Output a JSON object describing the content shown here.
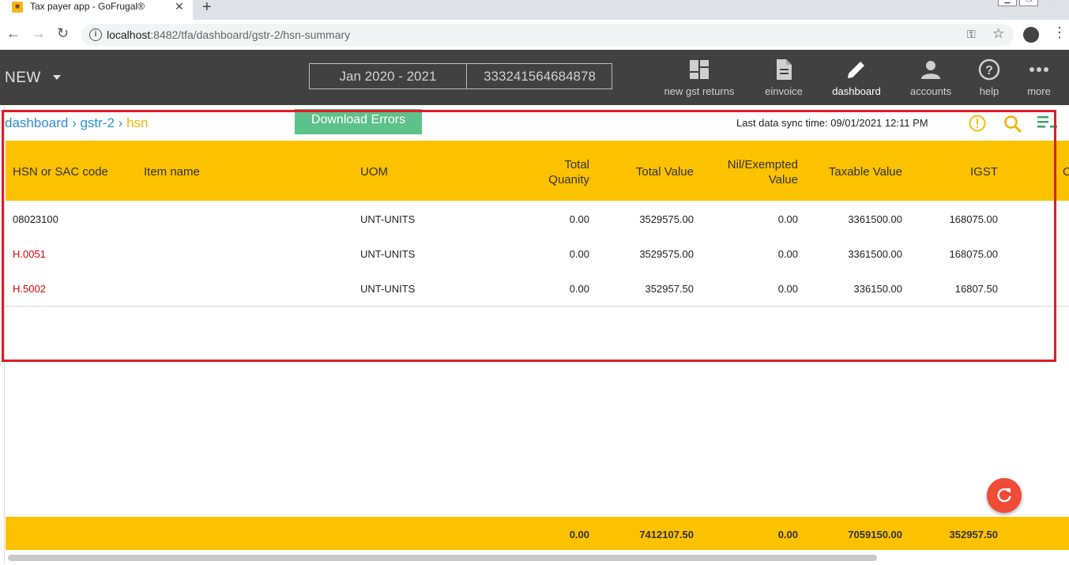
{
  "browser": {
    "tab_title": "Tax payer app - GoFrugal®",
    "url_host": "localhost",
    "url_path": ":8482/tfa/dashboard/gstr-2/hsn-summary"
  },
  "header": {
    "new_label": "NEW",
    "period": "Jan 2020 - 2021",
    "gstin": "333241564684878",
    "nav": [
      {
        "label": "new gst returns",
        "icon": "dashboard-grid-icon"
      },
      {
        "label": "einvoice",
        "icon": "document-icon"
      },
      {
        "label": "dashboard",
        "icon": "pencil-icon"
      },
      {
        "label": "accounts",
        "icon": "person-icon"
      },
      {
        "label": "help",
        "icon": "help-circle-icon"
      },
      {
        "label": "more",
        "icon": "more-dots-icon"
      }
    ]
  },
  "breadcrumb": {
    "items": [
      "dashboard",
      "gstr-2",
      "hsn"
    ],
    "sep": ">"
  },
  "download_errors_label": "Download Errors",
  "sync_text": "Last data sync time: 09/01/2021 12:11 PM",
  "table": {
    "headers": {
      "hsn": "HSN or SAC code",
      "item": "Item name",
      "uom": "UOM",
      "qty_1": "Total",
      "qty_2": "Quanity",
      "value": "Total Value",
      "nil_1": "Nil/Exempted",
      "nil_2": "Value",
      "taxable": "Taxable Value",
      "igst": "IGST",
      "partial": "C"
    },
    "rows": [
      {
        "hsn": "08023100",
        "item": "",
        "uom": "UNT-UNITS",
        "qty": "0.00",
        "value": "3529575.00",
        "nil": "0.00",
        "taxable": "3361500.00",
        "igst": "168075.00"
      },
      {
        "hsn": "H.0051",
        "item": "",
        "uom": "UNT-UNITS",
        "qty": "0.00",
        "value": "3529575.00",
        "nil": "0.00",
        "taxable": "3361500.00",
        "igst": "168075.00"
      },
      {
        "hsn": "H.5002",
        "item": "",
        "uom": "UNT-UNITS",
        "qty": "0.00",
        "value": "352957.50",
        "nil": "0.00",
        "taxable": "336150.00",
        "igst": "16807.50"
      }
    ],
    "totals": {
      "qty": "0.00",
      "value": "7412107.50",
      "nil": "0.00",
      "taxable": "7059150.00",
      "igst": "352957.50"
    }
  },
  "colors": {
    "header_bg": "#414141",
    "table_yellow": "#fcc200",
    "accent_blue": "#2b8fd6",
    "error_red": "#e00000",
    "fab_red": "#ef4b36",
    "download_green": "#5dc18a"
  }
}
